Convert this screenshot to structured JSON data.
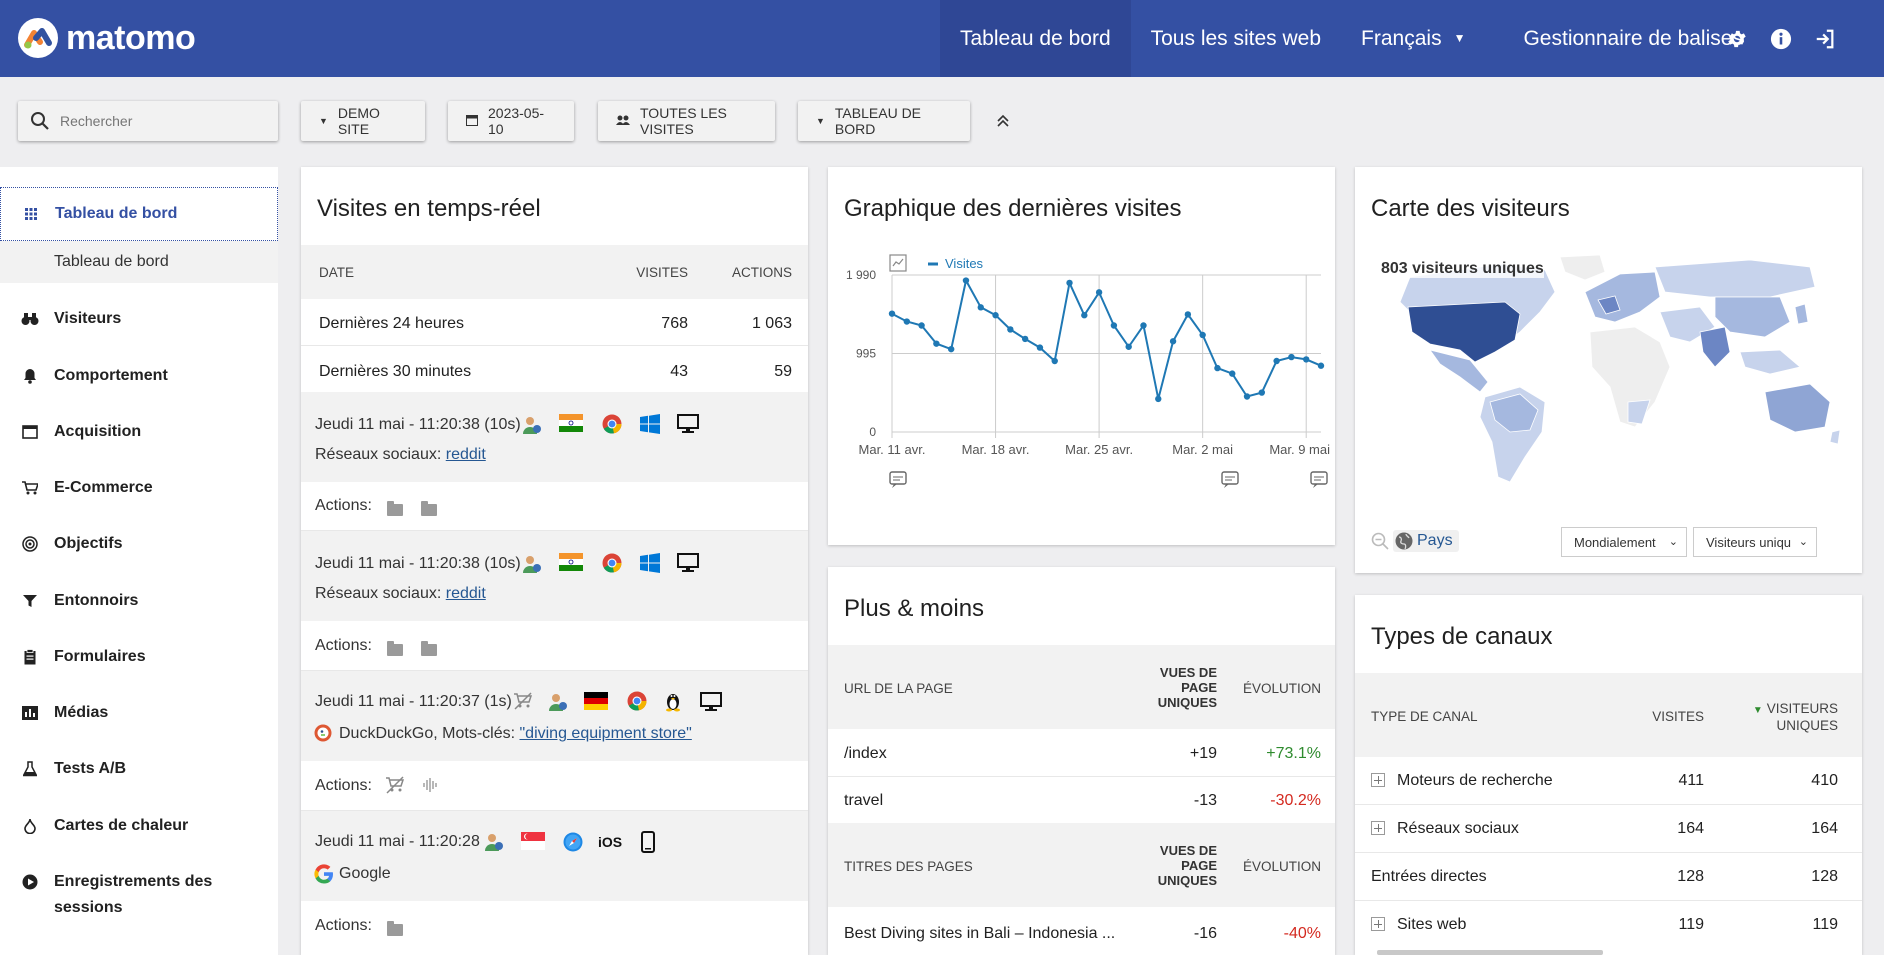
{
  "app": {
    "logo_text": "matomo",
    "nav": {
      "dashboard": "Tableau de bord",
      "all_sites": "Tous les sites web",
      "language": "Français",
      "tag_manager": "Gestionnaire de balises"
    }
  },
  "controls": {
    "search_placeholder": "Rechercher",
    "site": "DEMO SITE",
    "date": "2023-05-10",
    "segment": "TOUTES LES VISITES",
    "dashboard": "TABLEAU DE BORD"
  },
  "sidebar": {
    "active": "Tableau de bord",
    "sub": "Tableau de bord",
    "items": [
      "Visiteurs",
      "Comportement",
      "Acquisition",
      "E-Commerce",
      "Objectifs",
      "Entonnoirs",
      "Formulaires",
      "Médias",
      "Tests A/B",
      "Cartes de chaleur",
      "Enregistrements des sessions"
    ]
  },
  "realtime": {
    "title": "Visites en temps-réel",
    "headers": {
      "date": "DATE",
      "visits": "VISITES",
      "actions": "ACTIONS"
    },
    "rows": [
      {
        "label": "Dernières 24 heures",
        "visits": "768",
        "actions": "1 063"
      },
      {
        "label": "Dernières 30 minutes",
        "visits": "43",
        "actions": "59"
      }
    ],
    "visits": [
      {
        "time": "Jeudi 11 mai - 11:20:38 (10s)",
        "referrer_prefix": "Réseaux sociaux: ",
        "referrer_link": "reddit",
        "actions_label": "Actions:"
      },
      {
        "time": "Jeudi 11 mai - 11:20:38 (10s)",
        "referrer_prefix": "Réseaux sociaux: ",
        "referrer_link": "reddit",
        "actions_label": "Actions:"
      },
      {
        "time": "Jeudi 11 mai - 11:20:37 (1s)",
        "referrer_prefix": "DuckDuckGo, Mots-clés: ",
        "referrer_link": "\"diving equipment store\"",
        "actions_label": "Actions:"
      },
      {
        "time": "Jeudi 11 mai - 11:20:28",
        "referrer_prefix": "Google",
        "referrer_link": "",
        "os_text": "iOS",
        "actions_label": "Actions:"
      }
    ]
  },
  "graph": {
    "title": "Graphique des dernières visites",
    "chart_data": {
      "type": "line",
      "series": [
        {
          "name": "Visites",
          "values": [
            1500,
            1400,
            1350,
            1120,
            1050,
            1920,
            1580,
            1480,
            1300,
            1180,
            1070,
            900,
            1890,
            1480,
            1770,
            1350,
            1080,
            1350,
            420,
            1150,
            1490,
            1230,
            810,
            740,
            450,
            500,
            900,
            950,
            920,
            840
          ]
        }
      ],
      "x_tick_labels": [
        "Mar. 11 avr.",
        "Mar. 18 avr.",
        "Mar. 25 avr.",
        "Mar. 2 mai",
        "Mar. 9 mai"
      ],
      "y_tick_labels": [
        "1 990",
        "995",
        "0"
      ],
      "ylim": [
        0,
        1990
      ],
      "grid": true,
      "legend": "top-left"
    }
  },
  "map": {
    "title": "Carte des visiteurs",
    "unique_visitors": "803 visiteurs uniques",
    "pays": "Pays",
    "select_region": "Mondialement",
    "select_metric": "Visiteurs uniqu"
  },
  "plusmoins": {
    "title": "Plus & moins",
    "h1": {
      "label": "URL DE LA PAGE",
      "col1": "VUES DE PAGE UNIQUES",
      "col2": "ÉVOLUTION"
    },
    "rows1": [
      {
        "label": "/index",
        "val": "+19",
        "evo": "+73.1%"
      },
      {
        "label": "travel",
        "val": "-13",
        "evo": "-30.2%"
      }
    ],
    "h2": {
      "label": "TITRES DES PAGES",
      "col1": "VUES DE PAGE UNIQUES",
      "col2": "ÉVOLUTION"
    },
    "rows2": [
      {
        "label": "Best Diving sites in Bali – Indonesia ...",
        "val": "-16",
        "evo": "-40%"
      }
    ]
  },
  "channels": {
    "title": "Types de canaux",
    "headers": {
      "type": "TYPE DE CANAL",
      "visits": "VISITES",
      "unique": "VISITEURS UNIQUES"
    },
    "rows": [
      {
        "label": "Moteurs de recherche",
        "visits": "411",
        "unique": "410"
      },
      {
        "label": "Réseaux sociaux",
        "visits": "164",
        "unique": "164"
      },
      {
        "label": "Entrées directes",
        "visits": "128",
        "unique": "128"
      },
      {
        "label": "Sites web",
        "visits": "119",
        "unique": "119"
      }
    ]
  },
  "colors": {
    "brand": "#3450a3",
    "line": "#1f78b4",
    "green": "#2e8b2e",
    "red": "#d4291f"
  }
}
